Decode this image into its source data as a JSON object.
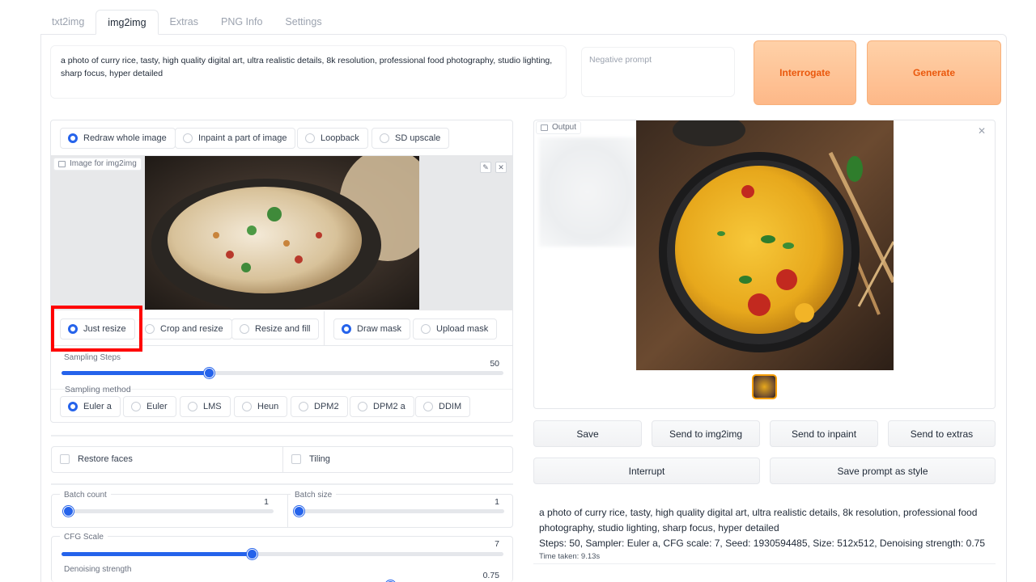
{
  "tabs": [
    "txt2img",
    "img2img",
    "Extras",
    "PNG Info",
    "Settings"
  ],
  "prompt": "a photo of curry rice, tasty, high quality digital art, ultra realistic details, 8k resolution, professional food photography, studio lighting, sharp focus, hyper detailed",
  "negative_prompt_placeholder": "Negative prompt",
  "buttons": {
    "interrogate": "Interrogate",
    "generate": "Generate"
  },
  "mode_options": [
    "Redraw whole image",
    "Inpaint a part of image",
    "Loopback",
    "SD upscale"
  ],
  "mode_selected": "Redraw whole image",
  "image_input_label": "Image for img2img",
  "resize_options": [
    "Just resize",
    "Crop and resize",
    "Resize and fill"
  ],
  "resize_selected": "Just resize",
  "mask_options": [
    "Draw mask",
    "Upload mask"
  ],
  "mask_selected": "Draw mask",
  "sampling_steps": {
    "label": "Sampling Steps",
    "value": "50",
    "fraction": 0.33
  },
  "sampling_method": {
    "label": "Sampling method",
    "options": [
      "Euler a",
      "Euler",
      "LMS",
      "Heun",
      "DPM2",
      "DPM2 a",
      "DDIM"
    ],
    "selected": "Euler a"
  },
  "checkboxes": {
    "restore_faces": "Restore faces",
    "tiling": "Tiling"
  },
  "batch_count": {
    "label": "Batch count",
    "value": "1",
    "fraction": 0.0
  },
  "batch_size": {
    "label": "Batch size",
    "value": "1",
    "fraction": 0.0
  },
  "cfg_scale": {
    "label": "CFG Scale",
    "value": "7",
    "fraction": 0.43
  },
  "denoising_strength": {
    "label": "Denoising strength",
    "value": "0.75",
    "fraction": 0.75
  },
  "output": {
    "label": "Output",
    "actions": [
      "Save",
      "Send to img2img",
      "Send to inpaint",
      "Send to extras"
    ],
    "interrupt": "Interrupt",
    "save_style": "Save prompt as style",
    "info_prompt": "a photo of curry rice, tasty, high quality digital art, ultra realistic details, 8k resolution, professional food photography, studio lighting, sharp focus, hyper detailed",
    "info_params": "Steps: 50, Sampler: Euler a, CFG scale: 7, Seed: 1930594485, Size: 512x512, Denoising strength: 0.75",
    "time_taken": "Time taken: 9.13s"
  },
  "colors": {
    "accent": "#2563eb",
    "generate_text": "#ea580c",
    "highlight_box": "#ff0000"
  }
}
